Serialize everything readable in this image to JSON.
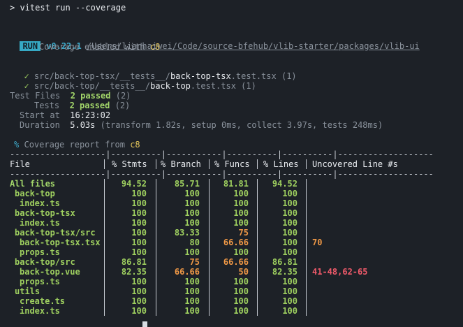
{
  "terminal": {
    "prompt_line": "> vitest run --coverage",
    "run_badge": "RUN",
    "version": "v0.22.1",
    "path": "/Users/lianhaiwei/Code/source-bfehub/vlib-starter/packages/vlib-ui",
    "coverage_enabled": "Coverage enabled with",
    "coverage_tool": "c8",
    "test_files": [
      {
        "check": "✓",
        "dir": "src/back-top-tsx/__tests__/",
        "name": "back-top-tsx",
        "ext": ".test.tsx",
        "count": "(1)"
      },
      {
        "check": "✓",
        "dir": "src/back-top/__tests__/",
        "name": "back-top",
        "ext": ".test.tsx",
        "count": "(1)"
      }
    ],
    "summary": {
      "test_files_label": "Test Files",
      "test_files_value": "2 passed",
      "test_files_count": "(2)",
      "tests_label": "Tests",
      "tests_value": "2 passed",
      "tests_count": "(2)",
      "start_label": "Start at",
      "start_value": "16:23:02",
      "duration_label": "Duration",
      "duration_value": "5.03s",
      "duration_detail": "(transform 1.82s, setup 0ms, collect 3.97s, tests 248ms)"
    },
    "coverage_report_prefix": "%",
    "coverage_report_label": "Coverage report from",
    "coverage_report_tool": "c8"
  },
  "table": {
    "headers": [
      "File",
      "% Stmts",
      "% Branch",
      "% Funcs",
      "% Lines",
      "Uncovered Line #s"
    ],
    "rows": [
      {
        "file": "All files",
        "stmts": "94.52",
        "branch": "85.71",
        "funcs": "81.81",
        "lines": "94.52",
        "uncovered": "",
        "indent": 0,
        "bold": true,
        "colors": [
          "green",
          "green",
          "green",
          "green"
        ]
      },
      {
        "file": "back-top",
        "stmts": "100",
        "branch": "100",
        "funcs": "100",
        "lines": "100",
        "uncovered": "",
        "indent": 1,
        "colors": [
          "green",
          "green",
          "green",
          "green"
        ]
      },
      {
        "file": "index.ts",
        "stmts": "100",
        "branch": "100",
        "funcs": "100",
        "lines": "100",
        "uncovered": "",
        "indent": 2,
        "colors": [
          "green",
          "green",
          "green",
          "green"
        ]
      },
      {
        "file": "back-top-tsx",
        "stmts": "100",
        "branch": "100",
        "funcs": "100",
        "lines": "100",
        "uncovered": "",
        "indent": 1,
        "colors": [
          "green",
          "green",
          "green",
          "green"
        ]
      },
      {
        "file": "index.ts",
        "stmts": "100",
        "branch": "100",
        "funcs": "100",
        "lines": "100",
        "uncovered": "",
        "indent": 2,
        "colors": [
          "green",
          "green",
          "green",
          "green"
        ]
      },
      {
        "file": "back-top-tsx/src",
        "stmts": "100",
        "branch": "83.33",
        "funcs": "75",
        "lines": "100",
        "uncovered": "",
        "indent": 1,
        "colors": [
          "green",
          "green",
          "orange",
          "green"
        ]
      },
      {
        "file": "back-top-tsx.tsx",
        "stmts": "100",
        "branch": "80",
        "funcs": "66.66",
        "lines": "100",
        "uncovered": "70",
        "indent": 2,
        "colors": [
          "green",
          "green",
          "orange",
          "green"
        ],
        "uncovered_color": "orange"
      },
      {
        "file": "props.ts",
        "stmts": "100",
        "branch": "100",
        "funcs": "100",
        "lines": "100",
        "uncovered": "",
        "indent": 2,
        "colors": [
          "green",
          "green",
          "green",
          "green"
        ]
      },
      {
        "file": "back-top/src",
        "stmts": "86.81",
        "branch": "75",
        "funcs": "66.66",
        "lines": "86.81",
        "uncovered": "",
        "indent": 1,
        "colors": [
          "green",
          "orange",
          "orange",
          "green"
        ]
      },
      {
        "file": "back-top.vue",
        "stmts": "82.35",
        "branch": "66.66",
        "funcs": "50",
        "lines": "82.35",
        "uncovered": "41-48,62-65",
        "indent": 2,
        "colors": [
          "green",
          "orange",
          "orange",
          "green"
        ],
        "uncovered_color": "red"
      },
      {
        "file": "props.ts",
        "stmts": "100",
        "branch": "100",
        "funcs": "100",
        "lines": "100",
        "uncovered": "",
        "indent": 2,
        "colors": [
          "green",
          "green",
          "green",
          "green"
        ]
      },
      {
        "file": "utils",
        "stmts": "100",
        "branch": "100",
        "funcs": "100",
        "lines": "100",
        "uncovered": "",
        "indent": 1,
        "colors": [
          "green",
          "green",
          "green",
          "green"
        ]
      },
      {
        "file": "create.ts",
        "stmts": "100",
        "branch": "100",
        "funcs": "100",
        "lines": "100",
        "uncovered": "",
        "indent": 2,
        "colors": [
          "green",
          "green",
          "green",
          "green"
        ]
      },
      {
        "file": "index.ts",
        "stmts": "100",
        "branch": "100",
        "funcs": "100",
        "lines": "100",
        "uncovered": "",
        "indent": 2,
        "colors": [
          "green",
          "green",
          "green",
          "green"
        ]
      }
    ]
  },
  "colors": {
    "background": "#1d2127",
    "green": "#a2d66a",
    "orange": "#ef9846",
    "red": "#ef5a6a",
    "cyan": "#36a9c4",
    "yellow": "#e4c65a"
  }
}
